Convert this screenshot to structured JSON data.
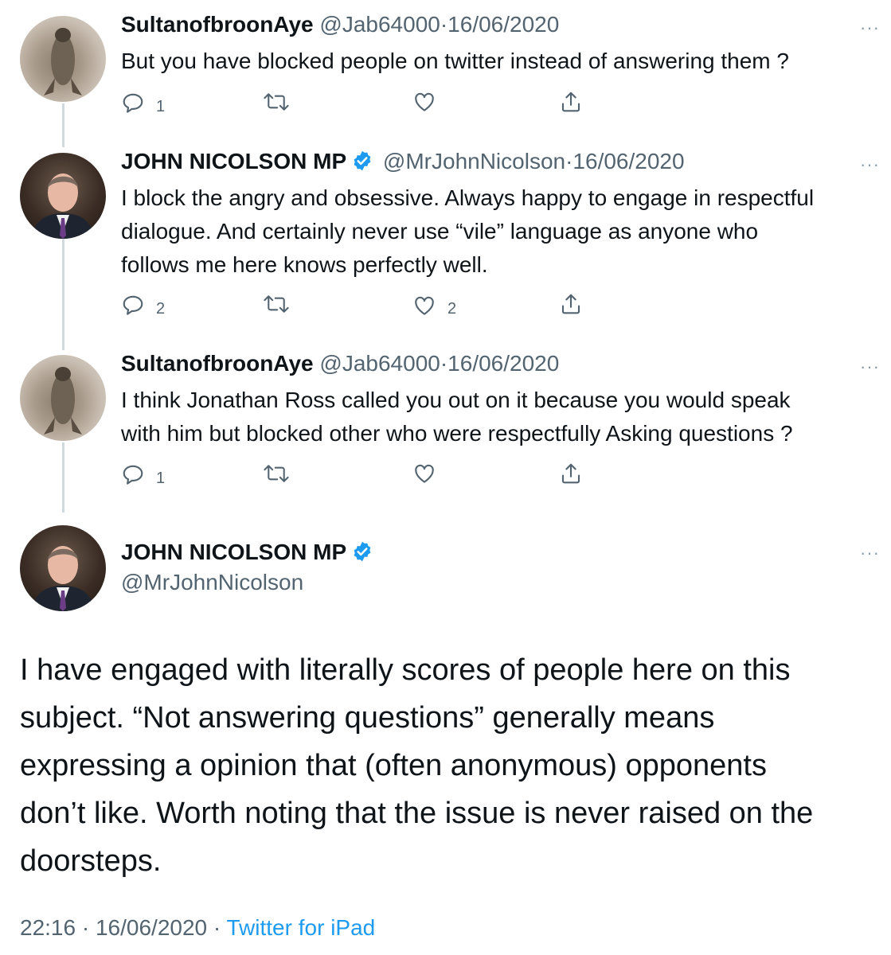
{
  "replies": [
    {
      "author": "SultanofbroonAye",
      "handle": "@Jab64000",
      "sep": "·",
      "date": "16/06/2020",
      "lines": [
        "But you have blocked people on twitter instead of answering them ?"
      ],
      "replies_count": "1",
      "retweets_count": "",
      "likes_count": ""
    },
    {
      "author": "JOHN NICOLSON MP",
      "handle": "@MrJohnNicolson",
      "sep": "·",
      "date": "16/06/2020",
      "lines": [
        "I block the angry and obsessive. Always happy to engage in respectful",
        "dialogue. And certainly never use “vile” language as anyone who",
        "follows me here knows perfectly well."
      ],
      "replies_count": "2",
      "retweets_count": "",
      "likes_count": "2"
    },
    {
      "author": "SultanofbroonAye",
      "handle": "@Jab64000",
      "sep": "·",
      "date": "16/06/2020",
      "lines": [
        "I think Jonathan Ross called you out on it because you would speak",
        "with him but blocked other who were respectfully Asking questions ?"
      ],
      "replies_count": "1",
      "retweets_count": "",
      "likes_count": ""
    }
  ],
  "main_tweet": {
    "author": "JOHN NICOLSON MP",
    "handle": "@MrJohnNicolson",
    "lines": [
      "I have engaged with literally scores of people here on this",
      "subject. “Not answering questions” generally means",
      "expressing a opinion that (often anonymous) opponents",
      "don’t like. Worth noting that the issue is never raised on the",
      "doorsteps."
    ],
    "time": "22:16",
    "sep": "·",
    "date": "16/06/2020",
    "source": "Twitter for iPad"
  },
  "more_label": "···",
  "colors": {
    "text": "#0f1419",
    "secondary": "#536471",
    "accent": "#1d9bf0",
    "verified": "#1d9bf0"
  },
  "icons": [
    "reply-icon",
    "retweet-icon",
    "like-icon",
    "share-icon",
    "verified-badge-icon",
    "more-options-icon"
  ]
}
